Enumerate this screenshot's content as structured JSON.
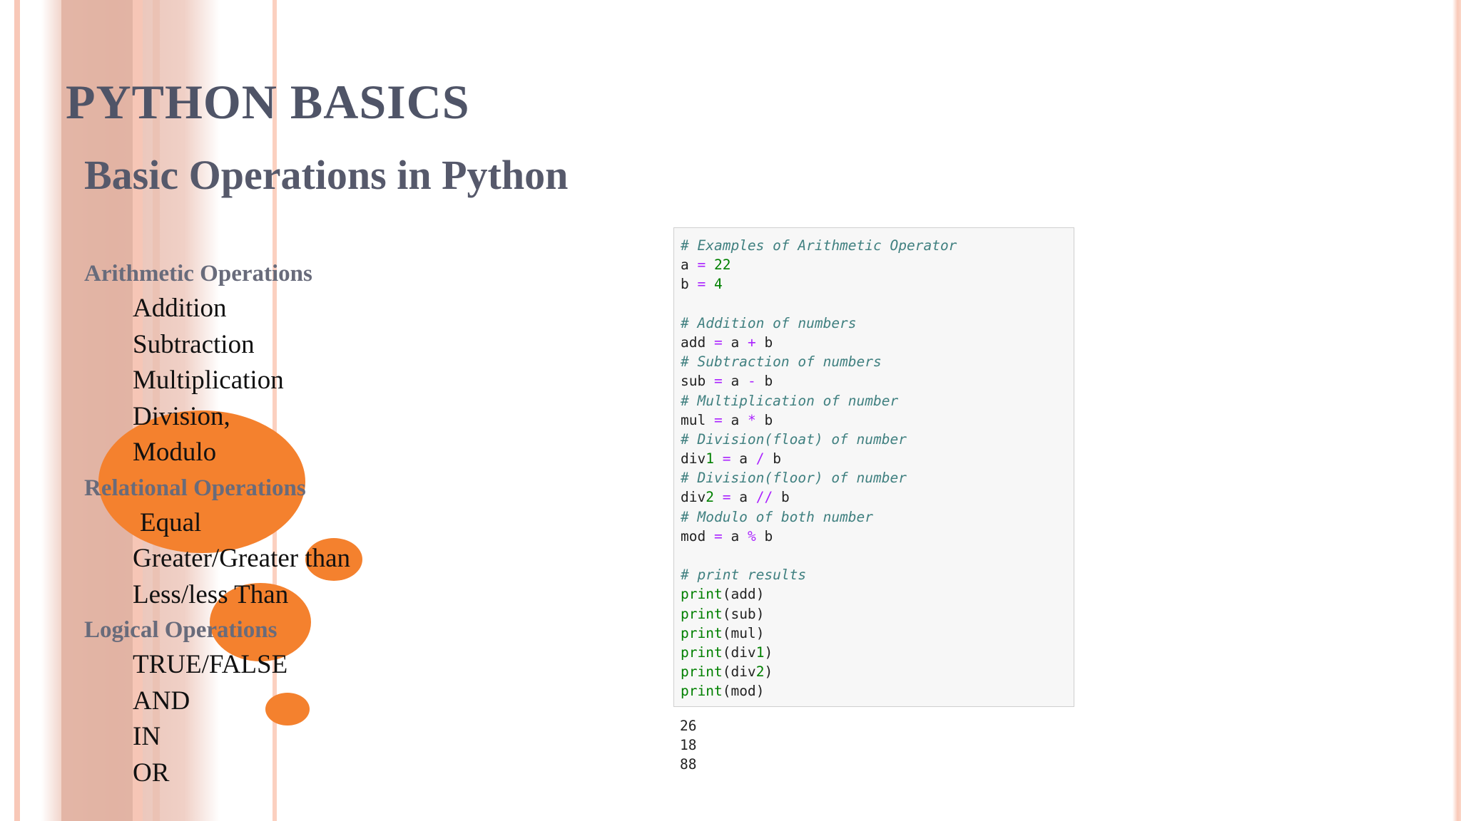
{
  "slide": {
    "title": "PYTHON BASICS",
    "subtitle": "Basic Operations in Python"
  },
  "outline": {
    "arithmetic": {
      "heading": "Arithmetic Operations",
      "items": [
        "Addition",
        "Subtraction",
        "Multiplication",
        "Division,",
        "Modulo"
      ]
    },
    "relational": {
      "heading": "Relational Operations",
      "items": [
        "Equal",
        "Greater/Greater than",
        "Less/less Than"
      ]
    },
    "logical": {
      "heading": "Logical Operations",
      "items": [
        "TRUE/FALSE",
        "AND",
        "IN",
        "OR"
      ]
    }
  },
  "code": {
    "lines": [
      "# Examples of Arithmetic Operator",
      "a = 22",
      "b = 4",
      "",
      "# Addition of numbers",
      "add = a + b",
      "# Subtraction of numbers",
      "sub = a - b",
      "# Multiplication of number",
      "mul = a * b",
      "# Division(float) of number",
      "div1 = a / b",
      "# Division(floor) of number",
      "div2 = a // b",
      "# Modulo of both number",
      "mod = a % b",
      "",
      "# print results",
      "print(add)",
      "print(sub)",
      "print(mul)",
      "print(div1)",
      "print(div2)",
      "print(mod)"
    ],
    "output": [
      "26",
      "18",
      "88"
    ]
  },
  "colors": {
    "title": "#4f5467",
    "heading": "#686b7b",
    "accent_orange": "#f4812e",
    "stripe_pink": "#f8c8b8",
    "code_background": "#f7f7f7",
    "code_comment": "#408080",
    "code_operator": "#aa22ff",
    "code_number": "#008000"
  }
}
